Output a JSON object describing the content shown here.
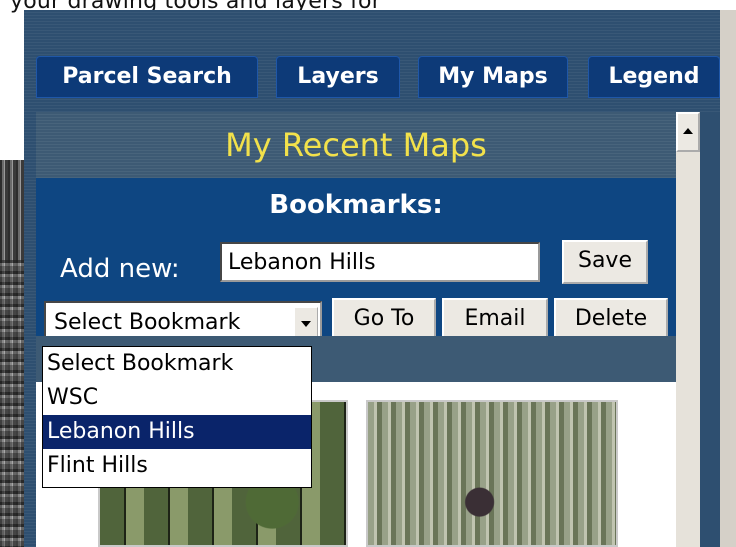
{
  "top_caption": "your drawing tools and layers for",
  "tabs": [
    {
      "label": "Parcel Search"
    },
    {
      "label": "Layers"
    },
    {
      "label": "My Maps"
    },
    {
      "label": "Legend"
    }
  ],
  "panel": {
    "title": "My Recent Maps"
  },
  "bookmarks": {
    "heading": "Bookmarks:",
    "add_label": "Add new:",
    "add_value": "Lebanon Hills",
    "save_label": "Save",
    "select_value": "Select Bookmark",
    "goto_label": "Go To",
    "email_label": "Email",
    "delete_label": "Delete",
    "options": [
      "Select Bookmark",
      "WSC",
      "Lebanon Hills",
      "Flint Hills"
    ],
    "highlighted_option": "Lebanon Hills"
  },
  "icons": {
    "dropdown_arrow": "chevron-down-icon",
    "scroll_up": "scroll-up-icon"
  },
  "colors": {
    "tab_bg": "#0d3a78",
    "title_text": "#f2e14b",
    "bookmarks_bg": "#0e4682",
    "selected_option_bg": "#0a246a"
  }
}
